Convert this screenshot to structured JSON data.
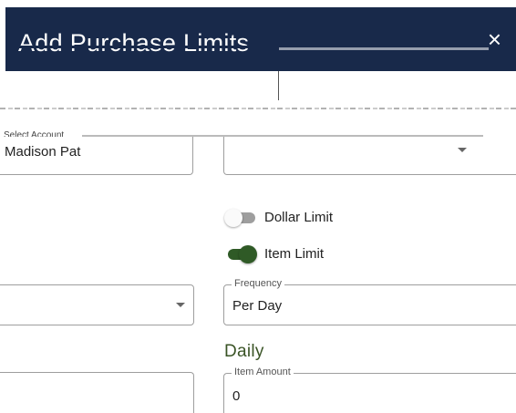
{
  "dialog": {
    "title": "Add Purchase Limits",
    "close_symbol": "×"
  },
  "account": {
    "label": "Select Account",
    "value": "Madison Pat"
  },
  "right_select": {
    "value": ""
  },
  "toggles": {
    "dollar_limit": {
      "label": "Dollar Limit",
      "on": false
    },
    "item_limit": {
      "label": "Item Limit",
      "on": true
    }
  },
  "left_select": {
    "value": ""
  },
  "frequency": {
    "label": "Frequency",
    "value": "Per Day"
  },
  "section": {
    "heading": "Daily"
  },
  "item_amount": {
    "label": "Item Amount",
    "value": "0"
  },
  "left_amount": {
    "value": ""
  },
  "colors": {
    "header_bg": "#18294a",
    "toggle_on": "#2f5a26",
    "heading": "#3a5426"
  }
}
